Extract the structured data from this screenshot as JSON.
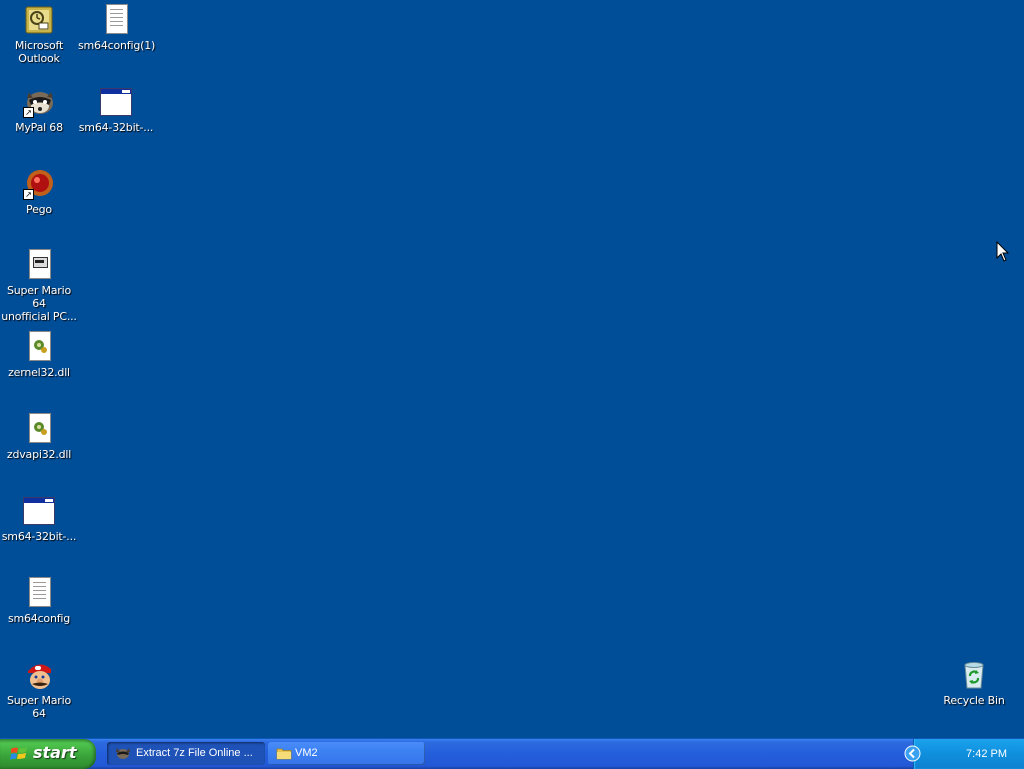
{
  "desktop": {
    "background_color": "#004e98",
    "icons": {
      "outlook": {
        "label": "Microsoft\nOutlook",
        "icon": "outlook-icon"
      },
      "sm64config1": {
        "label": "sm64config(1)",
        "icon": "text-document-icon"
      },
      "mypal": {
        "label": "MyPal 68",
        "icon": "raccoon-icon"
      },
      "sm64_32bit_a": {
        "label": "sm64-32bit-...",
        "icon": "application-window-icon"
      },
      "pego": {
        "label": "Pego",
        "icon": "pego-ball-icon"
      },
      "sm64_unofficial": {
        "label": "Super Mario 64\nunofficial PC...",
        "icon": "setup-file-icon"
      },
      "zernel32": {
        "label": "zernel32.dll",
        "icon": "dll-file-icon"
      },
      "zdvapi32": {
        "label": "zdvapi32.dll",
        "icon": "dll-file-icon"
      },
      "sm64_32bit_b": {
        "label": "sm64-32bit-...",
        "icon": "application-window-icon"
      },
      "sm64config": {
        "label": "sm64config",
        "icon": "text-document-icon"
      },
      "super_mario_64": {
        "label": "Super Mario 64",
        "icon": "mario-icon"
      },
      "recycle_bin": {
        "label": "Recycle Bin",
        "icon": "recycle-bin-icon"
      }
    }
  },
  "taskbar": {
    "start_label": "start",
    "tasks": [
      {
        "label": "Extract 7z File Online ...",
        "icon": "browser-icon",
        "state": "active"
      },
      {
        "label": "VM2",
        "icon": "folder-icon",
        "state": "normal"
      }
    ],
    "tray": {
      "clock": "7:42 PM",
      "icons": [
        "keyboard-icon",
        "show-hidden-icons-chevron"
      ]
    }
  }
}
